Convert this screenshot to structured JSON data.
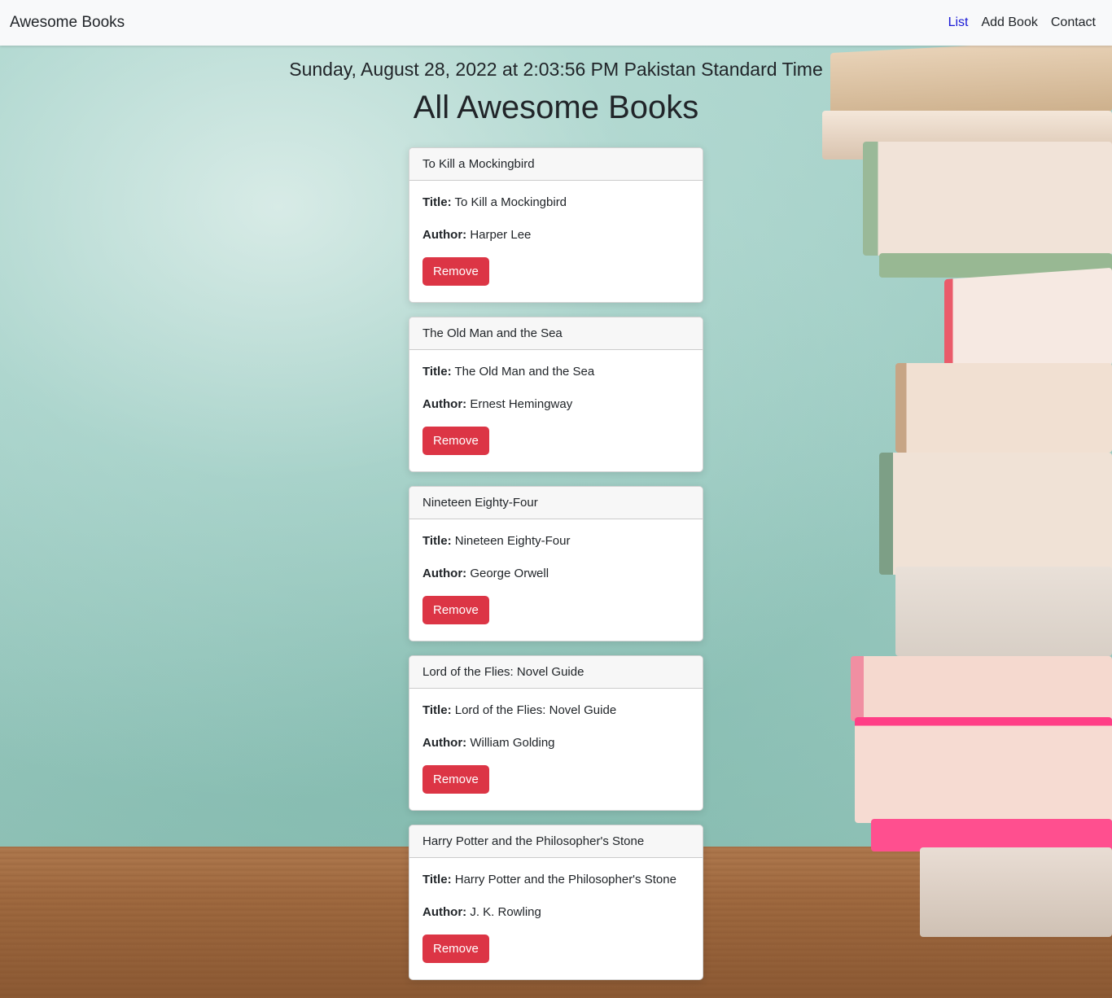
{
  "navbar": {
    "brand": "Awesome Books",
    "links": [
      {
        "label": "List",
        "active": true
      },
      {
        "label": "Add Book",
        "active": false
      },
      {
        "label": "Contact",
        "active": false
      }
    ]
  },
  "datetime": "Sunday, August 28, 2022 at 2:03:56 PM Pakistan Standard Time",
  "heading": "All Awesome Books",
  "labels": {
    "title": "Title:",
    "author": "Author:",
    "remove": "Remove"
  },
  "books": [
    {
      "header": "To Kill a Mockingbird",
      "title": "To Kill a Mockingbird",
      "author": "Harper Lee"
    },
    {
      "header": "The Old Man and the Sea",
      "title": "The Old Man and the Sea",
      "author": "Ernest Hemingway"
    },
    {
      "header": "Nineteen Eighty-Four",
      "title": "Nineteen Eighty-Four",
      "author": "George Orwell"
    },
    {
      "header": "Lord of the Flies: Novel Guide",
      "title": "Lord of the Flies: Novel Guide",
      "author": "William Golding"
    },
    {
      "header": "Harry Potter and the Philosopher's Stone",
      "title": "Harry Potter and the Philosopher's Stone",
      "author": "J. K. Rowling"
    }
  ],
  "colors": {
    "active_link": "#1a1ad6",
    "remove_button": "#dc3545",
    "navbar_bg": "#f8f9fa"
  }
}
